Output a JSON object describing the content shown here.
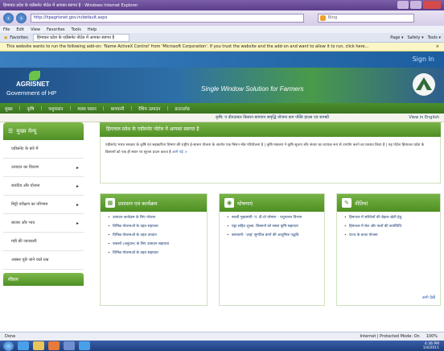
{
  "window": {
    "title": "हिमाचल प्रदेश के एग्रीसनेट पोर्टल में आपका स्वागत है - Windows Internet Explorer"
  },
  "address": {
    "url": "http://hpagrisnet.gov.in/default.aspx",
    "search_placeholder": "Bing"
  },
  "menu": [
    "File",
    "Edit",
    "View",
    "Favorites",
    "Tools",
    "Help"
  ],
  "favorites": {
    "label": "Favorites",
    "tab_label": "हिमाचल प्रदेश के एग्रीसनेट पोर्टल में आपका स्वागत है"
  },
  "command_bar": [
    "Page ▾",
    "Safety ▾",
    "Tools ▾"
  ],
  "infobar": {
    "text": "This website wants to run the following add-on: 'Name ActiveX Control' from 'Microsoft Corporation'. If you trust the website and the add-on and want to allow it to run, click here..."
  },
  "header": {
    "signin": "Sign In",
    "logo_word": "AGRISNET",
    "logo_sub": "Government of HP",
    "tagline": "Single Window Solution for Farmers"
  },
  "topnav": [
    "मुख्य",
    "कृषि",
    "पशुपालन",
    "मत्स्य पालन",
    "बागवानी",
    "रेशिम उत्पादन",
    "डाउनलोड"
  ],
  "ticker": {
    "text": "कृषि: पं दीनदयाल किसान बागवान समृद्धि योजना   कम पंक्ति हाउस एवं सामग्री",
    "view_english": "View in English"
  },
  "sidebar": {
    "title": "मुख्य मेन्यू",
    "items": [
      "एग्रीसनेट के बारे में",
      "उत्पादन का विवरण",
      "बजटिय और योजना",
      "मिट्टी परीक्षण का परिणाम",
      "बाजार और भाव",
      "मंडी की जानकारी",
      "अक्सर पूछे जाने वाले प्रश्न"
    ],
    "foot": "मौसम"
  },
  "welcome": {
    "title": "हिमाचल प्रदेश के एग्रीसनेट पोर्टल में आपका स्वागत है",
    "body": "एग्रीसनेट भारत सरकार के कृषि एवं सहकारिता विभाग की राष्ट्रीय ई-शासन योजना के अंतर्गत एक मिशन मोड परियोजना है | कृषि मंत्रालय ने कृषि सूचना और संचार का व्यापक रूप से उपयोग करने का प्रस्ताव किया है | यह पोर्टल हिमाचल प्रदेश के किसानों को एक ही स्थान पर सूचना प्रदान करता है",
    "more": "आगे पढ़ें >"
  },
  "boxes": {
    "schemes": {
      "title": "प्रशासन एवं कार्यक्रम",
      "items": [
        "उत्पादन कार्यक्रम के लिए योजना",
        "विभिन्न योजनाओं के तहत सहायता",
        "विभिन्न योजनाओं के तहत उपदान",
        "फसलों (अनुदान) के लिए उत्पादन सहायता",
        "विभिन्न योजनाओं के तहत सहायता"
      ]
    },
    "news": {
      "title": "घोषणाएं",
      "items": [
        "सब्जी मुख्यमंत्री: पं. दी.यो घोषणा - पशुपालन विभाग",
        "एड्रा सहित शुल्क: किसानों को सस्ता कृषि सहायता",
        "बागवानी: 'आह' सुगंधित बागों की आधुनिक पद्धति"
      ]
    },
    "policies": {
      "title": "नीतियां",
      "items": [
        "हिमाचल में सब्जियों की बेहतर खेती हेतु",
        "हिमाचल में बेल और फलों की कार्यविधि",
        "राज्य के बजट योजना"
      ],
      "more": "आगे देखें"
    }
  },
  "status": {
    "done": "Done",
    "zone": "Internet | Protected Mode: On",
    "zoom": "100%"
  },
  "taskbar": {
    "time": "4:36 PM",
    "date": "1/4/2011"
  }
}
